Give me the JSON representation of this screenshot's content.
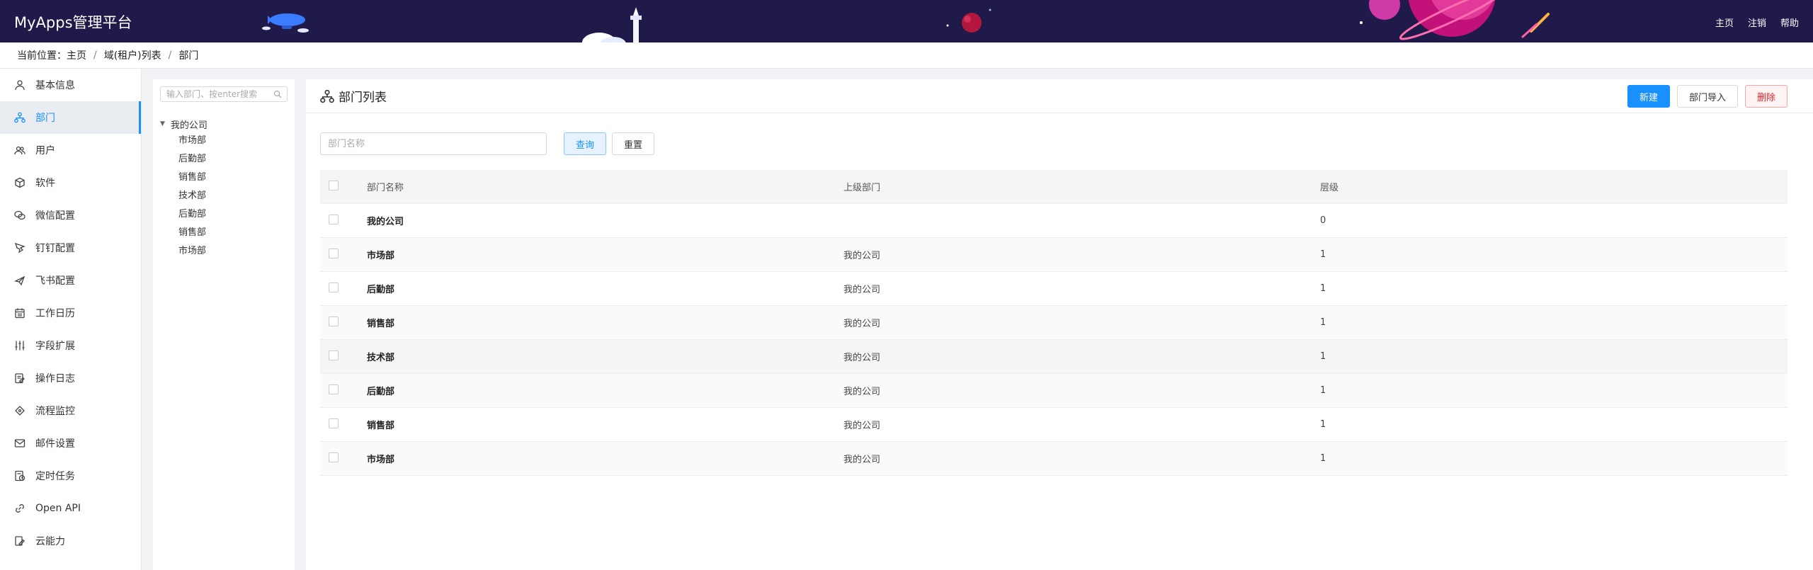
{
  "app": {
    "title": "MyApps管理平台"
  },
  "top_nav": {
    "home": "主页",
    "logout": "注销",
    "help": "帮助"
  },
  "breadcrumb": {
    "prefix": "当前位置：",
    "items": [
      "主页",
      "域(租户)列表",
      "部门"
    ]
  },
  "sidebar": {
    "items": [
      {
        "label": "基本信息",
        "icon": "user-icon"
      },
      {
        "label": "部门",
        "icon": "org-icon",
        "active": true
      },
      {
        "label": "用户",
        "icon": "users-icon"
      },
      {
        "label": "软件",
        "icon": "box-icon"
      },
      {
        "label": "微信配置",
        "icon": "wechat-icon"
      },
      {
        "label": "钉钉配置",
        "icon": "dingtalk-icon"
      },
      {
        "label": "飞书配置",
        "icon": "feishu-icon"
      },
      {
        "label": "工作日历",
        "icon": "calendar-icon"
      },
      {
        "label": "字段扩展",
        "icon": "sliders-icon"
      },
      {
        "label": "操作日志",
        "icon": "log-icon"
      },
      {
        "label": "流程监控",
        "icon": "monitor-icon"
      },
      {
        "label": "邮件设置",
        "icon": "mail-icon"
      },
      {
        "label": "定时任务",
        "icon": "timer-icon"
      },
      {
        "label": "Open API",
        "icon": "link-icon"
      },
      {
        "label": "云能力",
        "icon": "cloud-icon"
      }
    ]
  },
  "tree": {
    "search_placeholder": "输入部门、按enter搜索",
    "root": "我的公司",
    "children": [
      "市场部",
      "后勤部",
      "销售部",
      "技术部",
      "后勤部",
      "销售部",
      "市场部"
    ]
  },
  "main": {
    "title": "部门列表",
    "buttons": {
      "new": "新建",
      "import": "部门导入",
      "delete": "删除"
    },
    "filter": {
      "placeholder": "部门名称",
      "query": "查询",
      "reset": "重置"
    },
    "table": {
      "columns": [
        "部门名称",
        "上级部门",
        "层级"
      ],
      "rows": [
        {
          "name": "我的公司",
          "parent": "",
          "level": "0"
        },
        {
          "name": "市场部",
          "parent": "我的公司",
          "level": "1"
        },
        {
          "name": "后勤部",
          "parent": "我的公司",
          "level": "1"
        },
        {
          "name": "销售部",
          "parent": "我的公司",
          "level": "1"
        },
        {
          "name": "技术部",
          "parent": "我的公司",
          "level": "1"
        },
        {
          "name": "后勤部",
          "parent": "我的公司",
          "level": "1"
        },
        {
          "name": "销售部",
          "parent": "我的公司",
          "level": "1"
        },
        {
          "name": "市场部",
          "parent": "我的公司",
          "level": "1"
        }
      ]
    }
  },
  "colors": {
    "header_bg": "#1f1a4a",
    "accent": "#1890ff",
    "danger": "#f5222d"
  }
}
